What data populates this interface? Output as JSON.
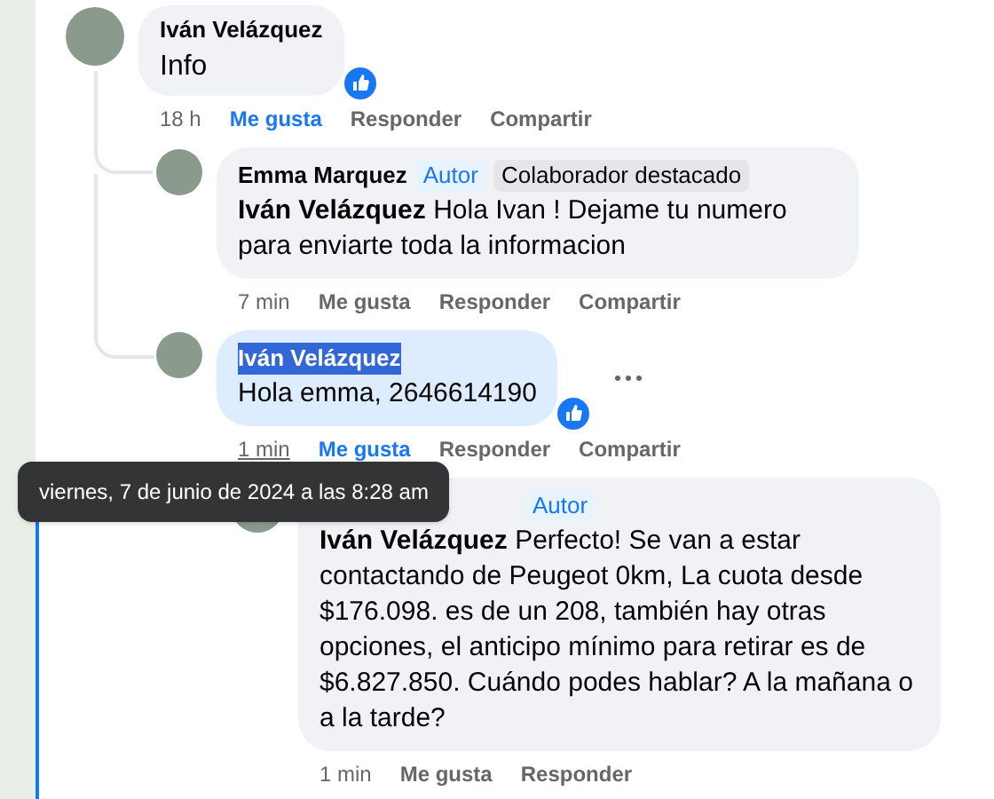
{
  "comments": [
    {
      "author": "Iván Velázquez",
      "text": "Info",
      "highlighted": false,
      "reacted": true,
      "show_more": false,
      "time": "18 h",
      "time_underlined": false,
      "liked": true,
      "actions": [
        "Me gusta",
        "Responder",
        "Compartir"
      ],
      "children": [
        {
          "author": "Emma Marquez",
          "badges": [
            {
              "kind": "author",
              "label": "Autor"
            },
            {
              "kind": "contributor",
              "label": "Colaborador destacado"
            }
          ],
          "mention": "Iván Velázquez",
          "text": "Hola Ivan ! Dejame tu numero para enviarte toda la informacion",
          "highlighted": false,
          "reacted": false,
          "show_more": false,
          "time": "7 min",
          "time_underlined": false,
          "liked": false,
          "actions": [
            "Me gusta",
            "Responder",
            "Compartir"
          ]
        },
        {
          "author": "Iván Velázquez",
          "text": "Hola emma, 2646614190",
          "highlighted": true,
          "reacted": true,
          "show_more": true,
          "time": "1 min",
          "time_underlined": true,
          "liked": true,
          "actions": [
            "Me gusta",
            "Responder",
            "Compartir"
          ],
          "children": [
            {
              "badges": [
                {
                  "kind": "author",
                  "label": "Autor"
                }
              ],
              "mention": "Iván Velázquez",
              "text": "Perfecto! Se van a estar contactando de Peugeot 0km, La cuota desde $176.098. es de un 208, también hay otras opciones, el anticipo mínimo para retirar es de $6.827.850. Cuándo podes hablar? A la mañana o a la tarde?",
              "highlighted": false,
              "reacted": false,
              "show_more": false,
              "time": "1 min",
              "time_underlined": false,
              "liked": false,
              "actions": [
                "Me gusta",
                "Responder"
              ]
            }
          ]
        }
      ]
    }
  ],
  "tooltip": {
    "text": "viernes, 7 de junio de 2024 a las 8:28 am"
  }
}
